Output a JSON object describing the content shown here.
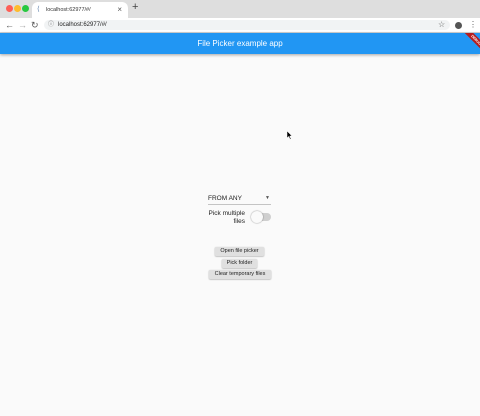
{
  "browser": {
    "tab": {
      "title": "localhost:62977/#/",
      "favicon": "flutter-icon"
    },
    "new_tab_label": "+",
    "url": "localhost:62977/#/"
  },
  "app": {
    "title": "File Picker example app",
    "debug_banner": "DEBUG",
    "accent_color": "#2196f3",
    "file_type_dropdown": {
      "value": "FROM ANY"
    },
    "pick_multiple": {
      "label": "Pick multiple files",
      "enabled": false
    },
    "buttons": {
      "open_file_picker": "Open file picker",
      "pick_folder": "Pick folder",
      "clear_temporary_files": "Clear temporary files"
    }
  }
}
